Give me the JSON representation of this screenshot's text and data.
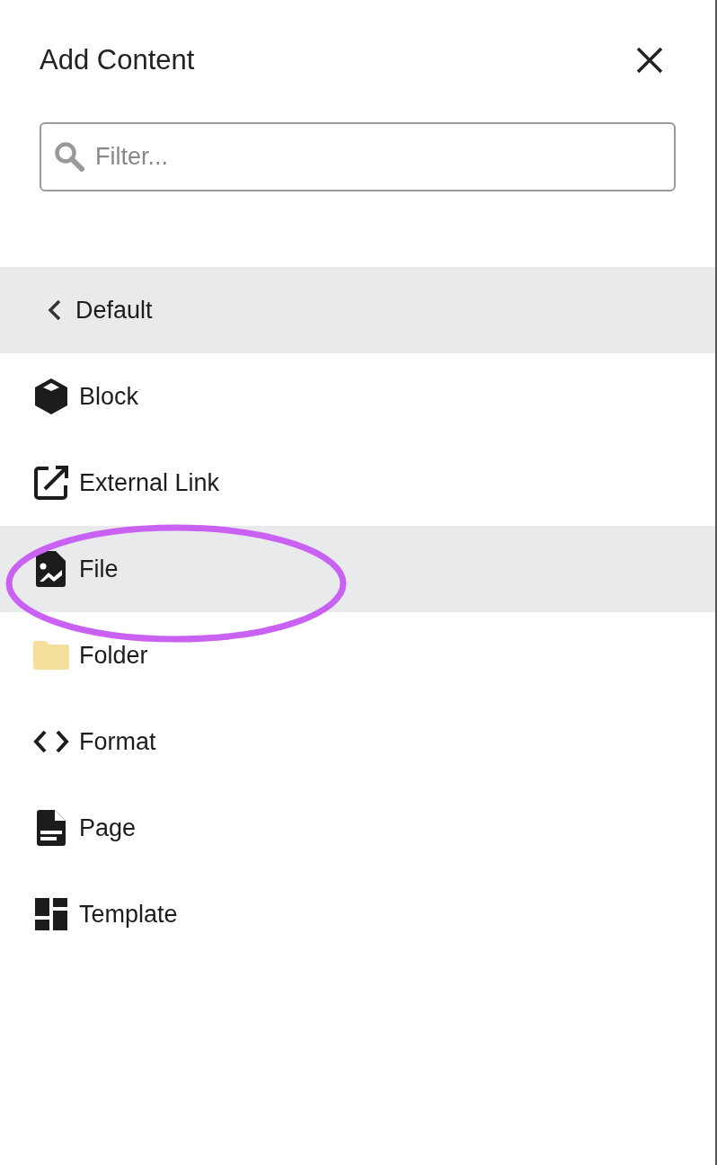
{
  "panel": {
    "title": "Add Content"
  },
  "search": {
    "placeholder": "Filter..."
  },
  "back": {
    "label": "Default"
  },
  "items": [
    {
      "label": "Block",
      "kind": "block",
      "selected": false,
      "circled": false
    },
    {
      "label": "External Link",
      "kind": "link",
      "selected": false,
      "circled": false
    },
    {
      "label": "File",
      "kind": "file",
      "selected": true,
      "circled": true
    },
    {
      "label": "Folder",
      "kind": "folder",
      "selected": false,
      "circled": false
    },
    {
      "label": "Format",
      "kind": "format",
      "selected": false,
      "circled": false
    },
    {
      "label": "Page",
      "kind": "page",
      "selected": false,
      "circled": false
    },
    {
      "label": "Template",
      "kind": "template",
      "selected": false,
      "circled": false
    }
  ]
}
